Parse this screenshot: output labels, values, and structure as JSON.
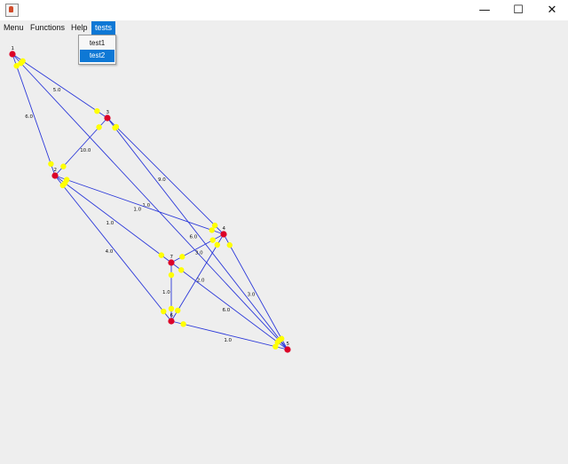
{
  "window": {
    "minimize_glyph": "—",
    "maximize_glyph": "☐",
    "close_glyph": "✕"
  },
  "menubar": {
    "items": [
      {
        "label": "Menu"
      },
      {
        "label": "Functions"
      },
      {
        "label": "Help"
      },
      {
        "label": "tests"
      }
    ]
  },
  "tests_menu": {
    "items": [
      {
        "label": "test1"
      },
      {
        "label": "test2"
      }
    ],
    "selected_index": 1
  },
  "graph": {
    "node_color": "#dc0028",
    "edge_color": "#2b38d9",
    "arrow_color": "#ffff00",
    "nodes": [
      {
        "id": "1",
        "label": "1"
      },
      {
        "id": "2",
        "label": "2"
      },
      {
        "id": "3",
        "label": "3"
      },
      {
        "id": "4",
        "label": "4"
      },
      {
        "id": "5",
        "label": "5"
      },
      {
        "id": "6",
        "label": "6"
      },
      {
        "id": "7",
        "label": "7"
      }
    ],
    "edges": [
      {
        "from": "1",
        "to": "3",
        "weight": "5.0"
      },
      {
        "from": "1",
        "to": "2",
        "weight": "6.0"
      },
      {
        "from": "1",
        "to": "5",
        "weight": "1.0"
      },
      {
        "from": "2",
        "to": "3",
        "weight": "10.0"
      },
      {
        "from": "3",
        "to": "4",
        "weight": "9.0"
      },
      {
        "from": "2",
        "to": "4",
        "weight": "1.0"
      },
      {
        "from": "2",
        "to": "7",
        "weight": "1.0"
      },
      {
        "from": "2",
        "to": "6",
        "weight": "4.0"
      },
      {
        "from": "3",
        "to": "5",
        "weight": "6.0"
      },
      {
        "from": "7",
        "to": "4",
        "weight": "3.0"
      },
      {
        "from": "7",
        "to": "6",
        "weight": "1.0"
      },
      {
        "from": "6",
        "to": "4",
        "weight": "2.0"
      },
      {
        "from": "7",
        "to": "5",
        "weight": "6.0"
      },
      {
        "from": "4",
        "to": "5",
        "weight": "3.0"
      },
      {
        "from": "6",
        "to": "5",
        "weight": "1.0"
      }
    ]
  }
}
